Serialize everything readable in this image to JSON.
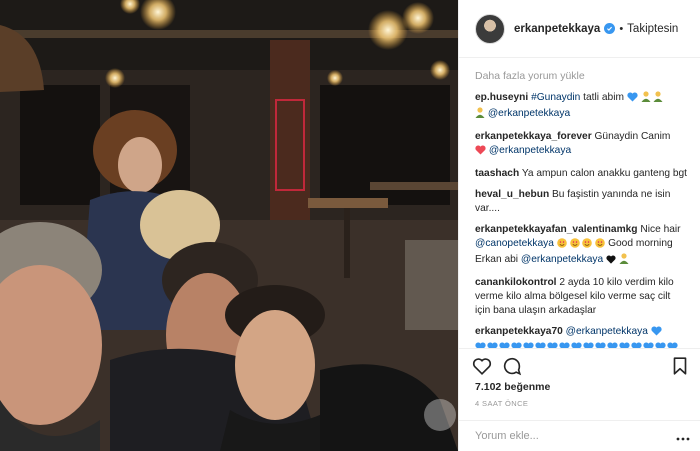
{
  "post": {
    "username": "erkanpetekkaya",
    "verified": true,
    "follow_state": "Takiptesin"
  },
  "comments_section": {
    "load_more": "Daha fazla yorum yükle",
    "items": [
      {
        "author": "ep.huseyni",
        "hashtag": "#Gunaydin",
        "text": " tatli abim ",
        "mention": "@erkanpetekkaya"
      },
      {
        "author": "erkanpetekkaya_forever",
        "text": " Günaydin Canim ",
        "mention": "@erkanpetekkaya"
      },
      {
        "author": "taashach",
        "text": " Ya ampun calon anakku ganteng bgt"
      },
      {
        "author": "heval_u_hebun",
        "text": " Bu faşistin yanında ne isin var...."
      },
      {
        "author": "erkanpetekkayafan_valentinamkg",
        "text": " Nice hair ",
        "mention": "@canopetekkaya",
        "text2": " Good morning Erkan abi ",
        "mention2": "@erkanpetekkaya"
      },
      {
        "author": "canankilokontrol",
        "text": " 2 ayda 10 kilo verdim kilo verme kilo alma bölgesel kilo verme saç cilt için bana ulaşın arkadaşlar"
      },
      {
        "author": "erkanpetekkaya70",
        "mention": "@erkanpetekkaya"
      }
    ]
  },
  "likes": "7.102 beğenme",
  "time": "4 SAAT ÖNCE",
  "add_comment_placeholder": "Yorum ekle...",
  "colors": {
    "heart_blue": "#3897f0",
    "heart_red": "#ed4956",
    "link": "#003569",
    "muted": "#999999"
  },
  "icons": [
    "like-icon",
    "comment-icon",
    "save-icon",
    "more-icon",
    "verified-badge-icon"
  ]
}
